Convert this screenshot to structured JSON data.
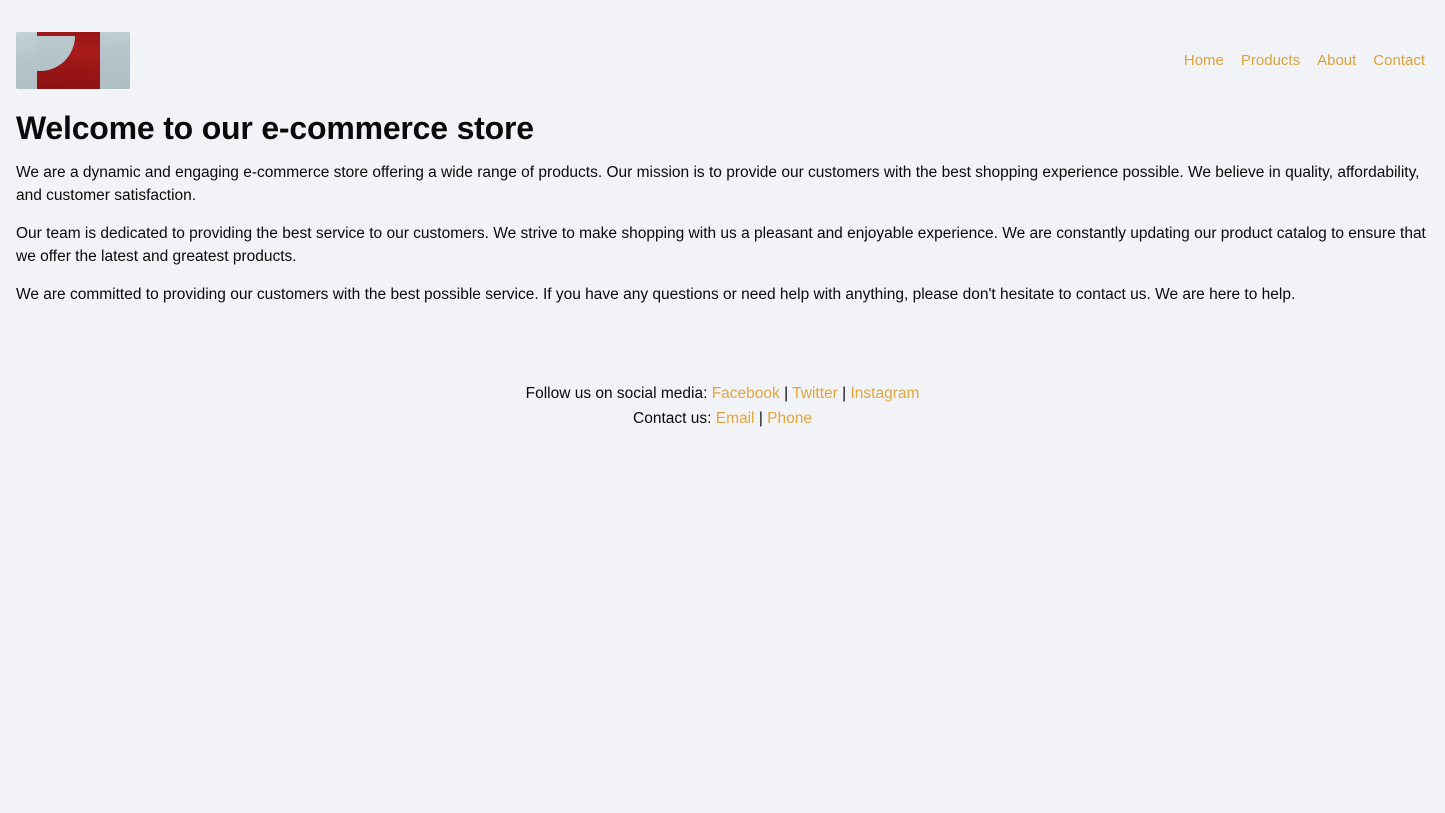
{
  "theme": {
    "background": "#f2f3f7",
    "accent": "#d9a23c",
    "text": "#0a0a0a"
  },
  "header": {
    "logo_alt": "store-logo",
    "nav": [
      {
        "label": "Home"
      },
      {
        "label": "Products"
      },
      {
        "label": "About"
      },
      {
        "label": "Contact"
      }
    ]
  },
  "main": {
    "title": "Welcome to our e-commerce store",
    "paragraphs": [
      "We are a dynamic and engaging e-commerce store offering a wide range of products. Our mission is to provide our customers with the best shopping experience possible. We believe in quality, affordability, and customer satisfaction.",
      "Our team is dedicated to providing the best service to our customers. We strive to make shopping with us a pleasant and enjoyable experience. We are constantly updating our product catalog to ensure that we offer the latest and greatest products.",
      "We are committed to providing our customers with the best possible service. If you have any questions or need help with anything, please don't hesitate to contact us. We are here to help."
    ]
  },
  "footer": {
    "social_label": "Follow us on social media:",
    "social_links": [
      {
        "label": "Facebook"
      },
      {
        "label": "Twitter"
      },
      {
        "label": "Instagram"
      }
    ],
    "contact_label": "Contact us:",
    "contact_links": [
      {
        "label": "Email"
      },
      {
        "label": "Phone"
      }
    ],
    "separator": "|"
  }
}
